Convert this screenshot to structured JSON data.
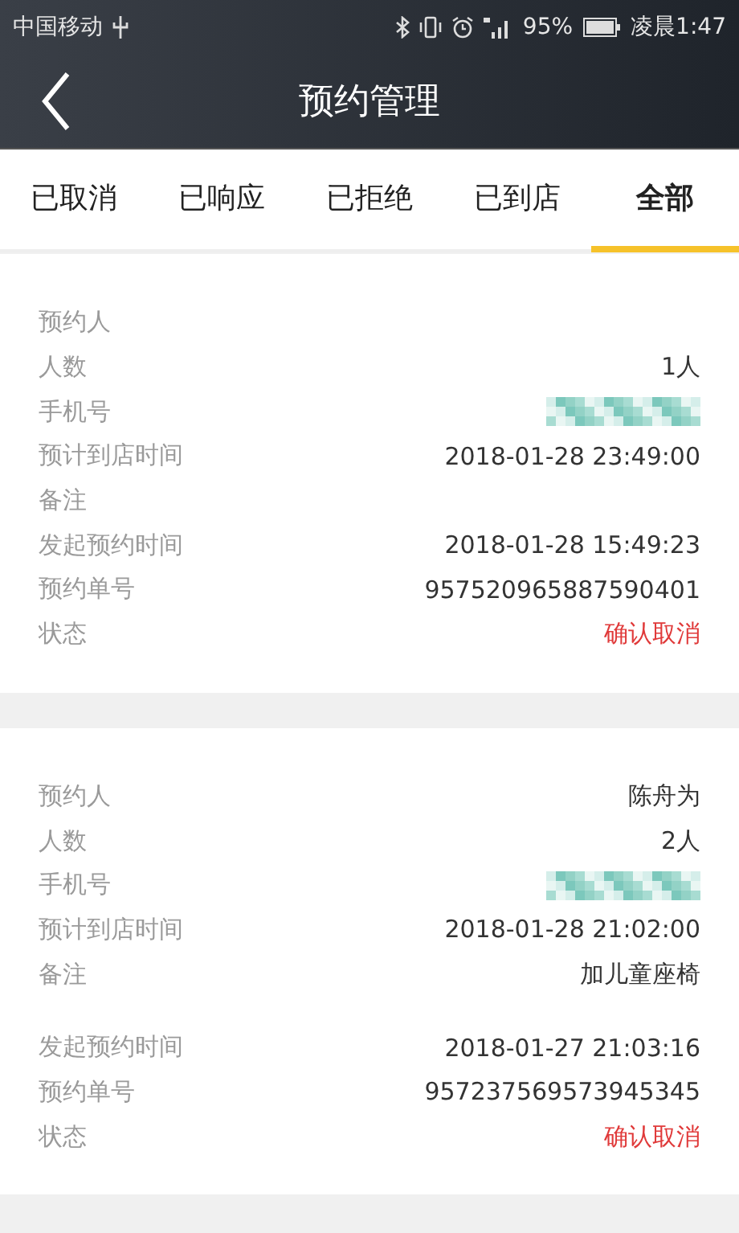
{
  "status_bar": {
    "carrier": "中国移动",
    "battery": "95%",
    "time": "凌晨1:47"
  },
  "nav": {
    "title": "预约管理"
  },
  "tabs": [
    {
      "label": "已取消",
      "selected": false
    },
    {
      "label": "已响应",
      "selected": false
    },
    {
      "label": "已拒绝",
      "selected": false
    },
    {
      "label": "已到店",
      "selected": false
    },
    {
      "label": "全部",
      "selected": true
    }
  ],
  "bookings": [
    {
      "rows": [
        {
          "kind": "text",
          "label": "预约人"
        },
        {
          "kind": "text",
          "label": "人数",
          "value": "1人"
        },
        {
          "kind": "masked",
          "label": "手机号"
        },
        {
          "kind": "text",
          "label": "预计到店时间",
          "value": "2018-01-28 23:49:00"
        },
        {
          "kind": "note",
          "label": "备注"
        },
        {
          "kind": "text",
          "label": "发起预约时间",
          "value": "2018-01-28 15:49:23"
        },
        {
          "kind": "text",
          "label": "预约单号",
          "value": "957520965887590401"
        },
        {
          "kind": "status",
          "label": "状态",
          "value": "确认取消"
        }
      ]
    },
    {
      "rows": [
        {
          "kind": "text",
          "label": "预约人",
          "value": "陈舟为"
        },
        {
          "kind": "text",
          "label": "人数",
          "value": "2人"
        },
        {
          "kind": "masked",
          "label": "手机号"
        },
        {
          "kind": "text",
          "label": "预计到店时间",
          "value": "2018-01-28 21:02:00"
        },
        {
          "kind": "note",
          "label": "备注",
          "value": "加儿童座椅"
        },
        {
          "kind": "text",
          "label": "发起预约时间",
          "value": "2018-01-27 21:03:16"
        },
        {
          "kind": "text",
          "label": "预约单号",
          "value": "957237569573945345"
        },
        {
          "kind": "status",
          "label": "状态",
          "value": "确认取消"
        }
      ]
    }
  ]
}
